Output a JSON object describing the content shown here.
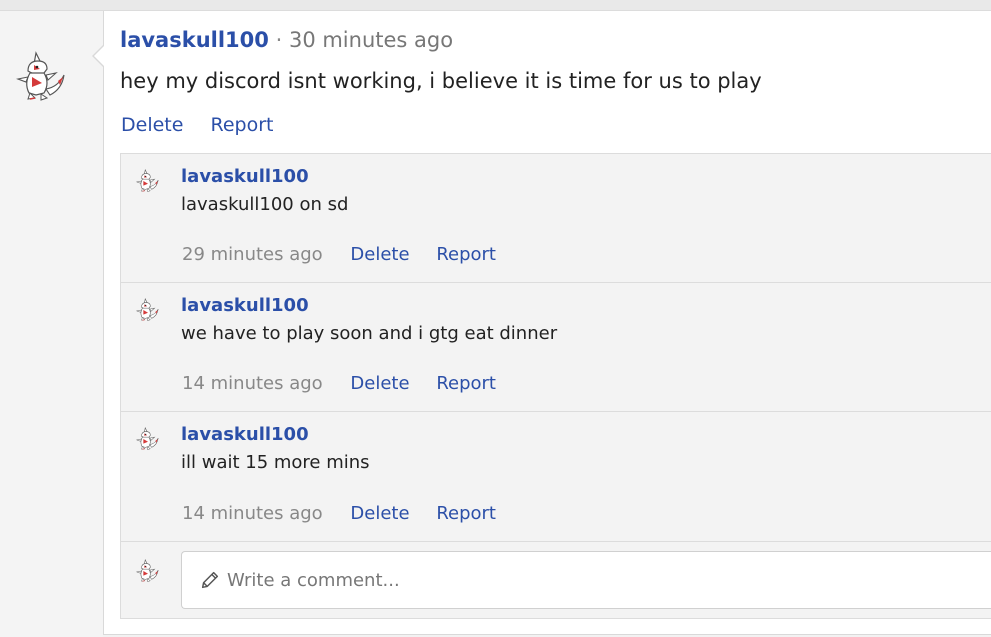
{
  "post": {
    "username": "lavaskull100",
    "separator": "·",
    "time": "30 minutes ago",
    "body": "hey my discord isnt working, i believe it is time for us to play",
    "actions": {
      "delete": "Delete",
      "report": "Report"
    }
  },
  "comments": [
    {
      "username": "lavaskull100",
      "text": "lavaskull100 on sd",
      "time": "29 minutes ago",
      "delete": "Delete",
      "report": "Report"
    },
    {
      "username": "lavaskull100",
      "text": "we have to play soon and i gtg eat dinner",
      "time": "14 minutes ago",
      "delete": "Delete",
      "report": "Report"
    },
    {
      "username": "lavaskull100",
      "text": "ill wait 15 more mins",
      "time": "14 minutes ago",
      "delete": "Delete",
      "report": "Report"
    }
  ],
  "new_comment": {
    "placeholder": "Write a comment..."
  },
  "icons": {
    "avatar": "zangoose-avatar-icon",
    "pencil": "pencil-icon"
  },
  "colors": {
    "link": "#2b4fa8",
    "muted": "#888888",
    "avatar_red": "#d43a3a"
  }
}
